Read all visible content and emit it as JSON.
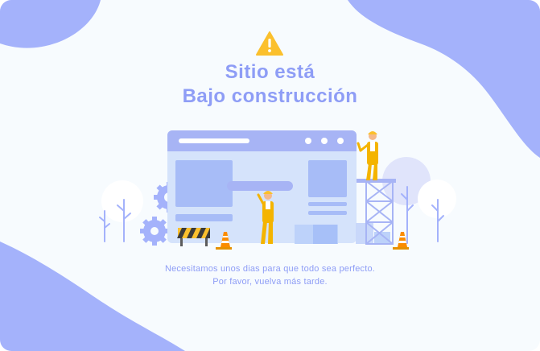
{
  "page": {
    "title_line1": "Sitio está",
    "title_line2": "Bajo construcción",
    "message_line1": "Necesitamos unos dias para que todo sea perfecto.",
    "message_line2": "Por favor, vuelva más tarde."
  },
  "icons": {
    "warning": "warning-triangle-icon",
    "gear": "gear-icon",
    "traffic_cone": "traffic-cone-icon",
    "barrier": "construction-barrier-icon"
  },
  "colors": {
    "accent": "#8e9df6",
    "blob": "#a4b2fb",
    "warning": "#fbc02d",
    "worker": "#f4b400",
    "browser_light": "#d5e3fb",
    "browser_bar": "#a7b4f5"
  }
}
